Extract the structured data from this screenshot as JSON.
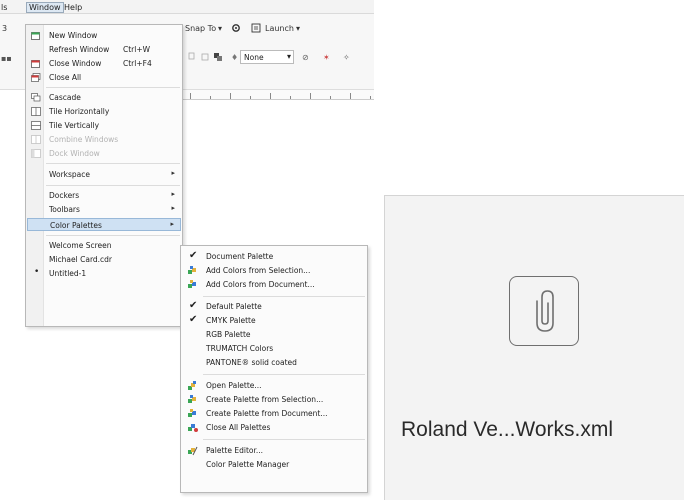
{
  "menubar": {
    "partial_left": "ls",
    "window_label": "Window",
    "help_label": "Help"
  },
  "toolbar": {
    "snap_to_label": "Snap To",
    "launch_label": "Launch",
    "none_value": "None",
    "left_digit": "3"
  },
  "window_menu": {
    "items": [
      {
        "label": "New Window",
        "icon": "new-window-icon"
      },
      {
        "label": "Refresh Window",
        "shortcut": "Ctrl+W"
      },
      {
        "label": "Close Window",
        "shortcut": "Ctrl+F4",
        "icon": "close-window-icon"
      },
      {
        "label": "Close All",
        "icon": "close-all-icon"
      },
      {
        "label": "Cascade",
        "icon": "cascade-icon"
      },
      {
        "label": "Tile Horizontally",
        "icon": "tile-horizontal-icon"
      },
      {
        "label": "Tile Vertically",
        "icon": "tile-vertical-icon"
      },
      {
        "label": "Combine Windows",
        "icon": "combine-windows-icon",
        "disabled": true
      },
      {
        "label": "Dock Window",
        "icon": "dock-window-icon",
        "disabled": true
      },
      {
        "label": "Workspace"
      },
      {
        "label": "Dockers"
      },
      {
        "label": "Toolbars"
      },
      {
        "label": "Color Palettes"
      },
      {
        "label": "Welcome Screen"
      },
      {
        "label": "Michael Card.cdr"
      },
      {
        "label": "Untitled-1"
      }
    ]
  },
  "palette_menu": {
    "items": [
      {
        "label": "Document Palette",
        "checked": true
      },
      {
        "label": "Add Colors from Selection...",
        "icon": "add-colors-selection-icon"
      },
      {
        "label": "Add Colors from Document...",
        "icon": "add-colors-document-icon"
      },
      {
        "label": "Default Palette",
        "checked": true
      },
      {
        "label": "CMYK Palette",
        "checked": true
      },
      {
        "label": "RGB Palette"
      },
      {
        "label": "TRUMATCH Colors"
      },
      {
        "label": "PANTONE® solid coated"
      },
      {
        "label": "Open Palette...",
        "icon": "open-palette-icon"
      },
      {
        "label": "Create Palette from Selection...",
        "icon": "create-palette-selection-icon"
      },
      {
        "label": "Create Palette from Document...",
        "icon": "create-palette-document-icon"
      },
      {
        "label": "Close All Palettes",
        "icon": "close-all-palettes-icon"
      },
      {
        "label": "Palette Editor...",
        "icon": "palette-editor-icon"
      },
      {
        "label": "Color Palette Manager"
      }
    ]
  },
  "attachment": {
    "file_name": "Roland Ve...Works.xml",
    "icon": "paperclip-icon"
  },
  "colors": {
    "highlight": "#cfe1f3",
    "highlight_border": "#98b8d8",
    "icon_green": "#3aa655",
    "icon_red": "#d23c3c",
    "card_bg": "#f3f3f3"
  }
}
